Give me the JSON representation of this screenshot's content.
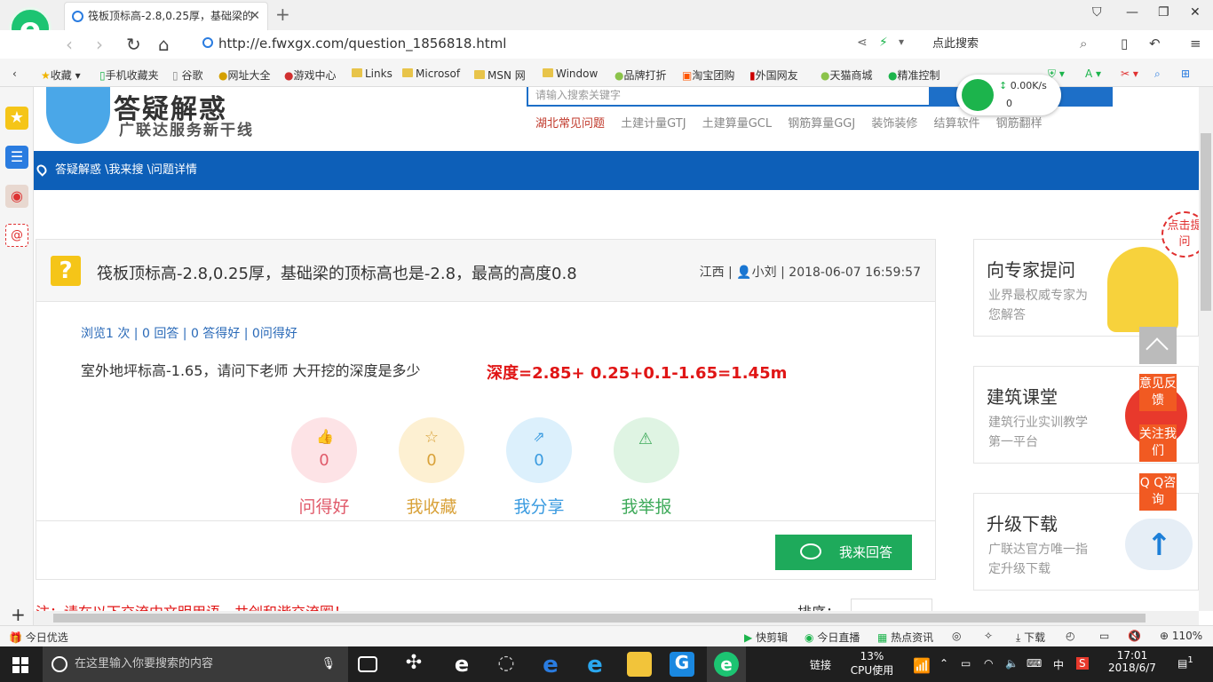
{
  "browser": {
    "tab_title": "筏板顶标高-2.8,0.25厚，基础梁的",
    "url": "http://e.fwxgx.com/question_1856818.html",
    "search_placeholder": "点此搜索",
    "favorites": [
      {
        "label": "收藏"
      },
      {
        "label": "手机收藏夹"
      },
      {
        "label": "谷歌"
      },
      {
        "label": "网址大全"
      },
      {
        "label": "游戏中心"
      },
      {
        "label": "Links"
      },
      {
        "label": "Microsof"
      },
      {
        "label": "MSN 网"
      },
      {
        "label": "Window"
      },
      {
        "label": "品牌打折"
      },
      {
        "label": "淘宝团购"
      },
      {
        "label": "外国网友"
      },
      {
        "label": "天猫商城"
      },
      {
        "label": "精准控制"
      }
    ],
    "net_speed": "0.00K/s",
    "net_count": "0"
  },
  "site": {
    "title": "答疑解惑",
    "subtitle": "广联达服务新干线",
    "search_placeholder": "请输入搜索关键字",
    "hot_links": [
      "湖北常见问题",
      "土建计量GTJ",
      "土建算量GCL",
      "钢筋算量GGJ",
      "装饰装修",
      "结算软件",
      "钢筋翻样"
    ],
    "breadcrumb": "答疑解惑 \\我来搜 \\问题详情"
  },
  "question": {
    "title": "筏板顶标高-2.8,0.25厚，基础梁的顶标高也是-2.8，最高的高度0.8",
    "region": "江西",
    "user": "小刘",
    "time": "2018-06-07 16:59:57",
    "stats": "浏览1 次 | 0 回答 | 0 答得好 | 0问得好",
    "body": "室外地坪标高-1.65，请问下老师 大开挖的深度是多少",
    "answer": "深度=2.85+ 0.25+0.1-1.65=1.45m",
    "actions": [
      {
        "label": "问得好",
        "count": "0",
        "color": "#e05a6a",
        "bg": "#fde3e6",
        "icon": "thumbs-up-icon"
      },
      {
        "label": "我收藏",
        "count": "0",
        "color": "#d9a23a",
        "bg": "#fdf0d2",
        "icon": "star-icon"
      },
      {
        "label": "我分享",
        "count": "0",
        "color": "#3a9be0",
        "bg": "#dcf0fc",
        "icon": "share-icon"
      },
      {
        "label": "我举报",
        "count": "0",
        "color": "#3eaa5a",
        "bg": "#dff4e3",
        "icon": "warning-icon"
      }
    ],
    "answer_button": "我来回答",
    "note": "注：请在以下交流中文明用语，共创和谐交流圈！",
    "sort_label": "排序："
  },
  "sidebar": {
    "boxes": [
      {
        "title": "向专家提问",
        "sub": "业界最权威专家为您解答"
      },
      {
        "title": "建筑课堂",
        "sub": "建筑行业实训教学第一平台"
      },
      {
        "title": "升级下载",
        "sub": "广联达官方唯一指定升级下载"
      }
    ],
    "float_buttons": [
      "意见反馈",
      "关注我们",
      "Q Q咨询"
    ],
    "badge": "点击提问"
  },
  "statusbar": {
    "left": "今日优选",
    "items": [
      "快剪辑",
      "今日直播",
      "热点资讯",
      "下载"
    ],
    "zoom": "110%"
  },
  "taskbar": {
    "search": "在这里输入你要搜索的内容",
    "link_label": "链接",
    "cpu_pct": "13%",
    "cpu_label": "CPU使用",
    "ime": "中",
    "time": "17:01",
    "date": "2018/6/7",
    "notif": "1"
  }
}
